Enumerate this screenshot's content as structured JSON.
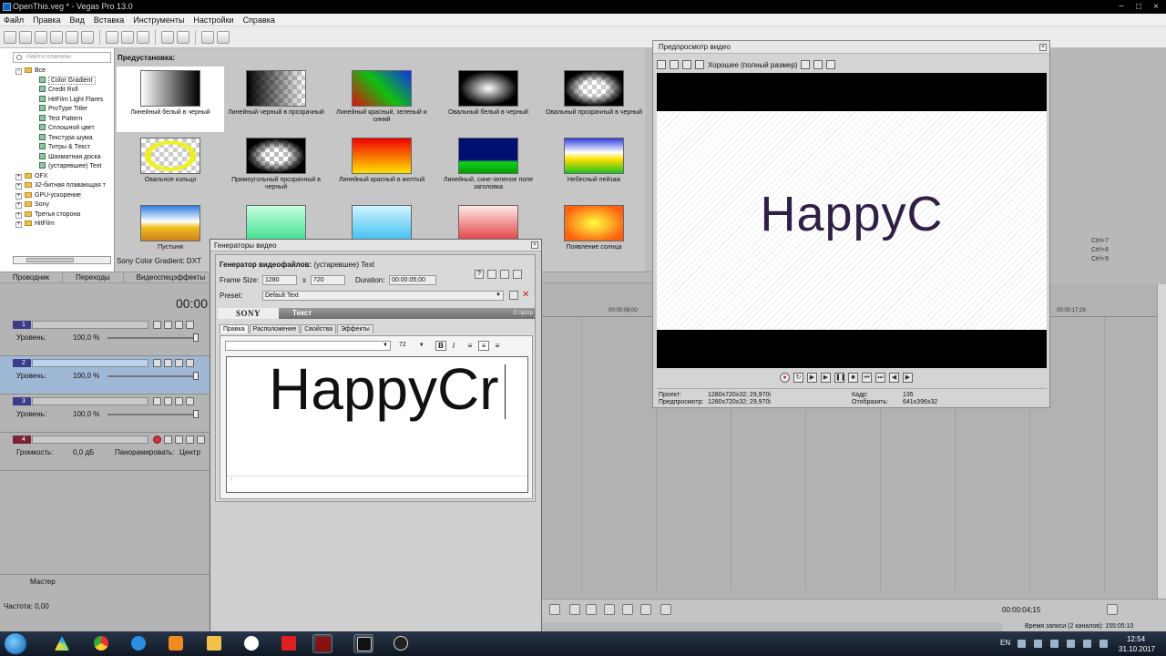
{
  "window": {
    "title": "OpenThis.veg * - Vegas Pro 13.0",
    "controls": [
      "−",
      "□",
      "×"
    ]
  },
  "menu": [
    "Файл",
    "Правка",
    "Вид",
    "Вставка",
    "Инструменты",
    "Настройки",
    "Справка"
  ],
  "explorer": {
    "search_placeholder": "Найти плагины",
    "tree": [
      {
        "label": "Все",
        "level": 0,
        "kind": "folder",
        "exp": "−"
      },
      {
        "label": "Color Gradient",
        "level": 1,
        "kind": "item",
        "selected": true
      },
      {
        "label": "Credit Roll",
        "level": 1,
        "kind": "item"
      },
      {
        "label": "HitFilm Light Flares",
        "level": 1,
        "kind": "item"
      },
      {
        "label": "ProType Titler",
        "level": 1,
        "kind": "item"
      },
      {
        "label": "Test Pattern",
        "level": 1,
        "kind": "item"
      },
      {
        "label": "Сплошной цвет",
        "level": 1,
        "kind": "item"
      },
      {
        "label": "Текстура шума",
        "level": 1,
        "kind": "item"
      },
      {
        "label": "Титры & Текст",
        "level": 1,
        "kind": "item"
      },
      {
        "label": "Шахматная доска",
        "level": 1,
        "kind": "item"
      },
      {
        "label": "(устаревшее) Text",
        "level": 1,
        "kind": "item"
      },
      {
        "label": "OFX",
        "level": 0,
        "kind": "folder",
        "exp": "+"
      },
      {
        "label": "32-битная плавающая т",
        "level": 0,
        "kind": "folder",
        "exp": "+"
      },
      {
        "label": "GPU-ускорение",
        "level": 0,
        "kind": "folder",
        "exp": "+"
      },
      {
        "label": "Sony",
        "level": 0,
        "kind": "folder",
        "exp": "+"
      },
      {
        "label": "Третья сторона",
        "level": 0,
        "kind": "folder",
        "exp": "+"
      },
      {
        "label": "HitFilm",
        "level": 0,
        "kind": "folder",
        "exp": "+"
      }
    ]
  },
  "presets": {
    "title": "Предустановка:",
    "status": "Sony Color Gradient: DXT",
    "items": [
      {
        "label": "Линейный белый в черный",
        "bg": "linear-gradient(90deg,#ffffff,#000000)",
        "selected": true
      },
      {
        "label": "Линейный черный в прозрачный",
        "bg": "linear-gradient(90deg,#000 0%,rgba(0,0,0,0) 100%),repeating-conic-gradient(#ccc 0% 25%,#fff 0% 50%) 0 0/10px 10px"
      },
      {
        "label": "Линейный красный, зеленый и синий",
        "bg": "linear-gradient(45deg,#e01010,#10c010 50%,#1030f0)"
      },
      {
        "label": "Овальный белый в черный",
        "bg": "radial-gradient(ellipse at center,#ffffff 0%,#000000 70%)"
      },
      {
        "label": "Овальный прозрачный в черный",
        "bg": "radial-gradient(ellipse at center,rgba(0,0,0,0) 30%,#000 72%),repeating-conic-gradient(#ccc 0% 25%,#fff 0% 50%) 0 0/10px 10px"
      },
      {
        "label": "Овальное кольцо",
        "bg": "radial-gradient(ellipse at center,rgba(0,0,0,0) 45%,#f0f020 50%,#f0f020 58%,rgba(0,0,0,0) 66%),repeating-conic-gradient(#ccc 0% 25%,#fff 0% 50%) 0 0/10px 10px"
      },
      {
        "label": "Прямоугольный прозрачный в черный",
        "bg": "radial-gradient(closest-side,rgba(0,0,0,0) 40%,#000 100%),repeating-conic-gradient(#bbb 0% 25%,#fff 0% 50%) 0 0/10px 10px"
      },
      {
        "label": "Линейный красный в желтый",
        "bg": "linear-gradient(180deg,#f00000,#ffe000)"
      },
      {
        "label": "Линейный, сине-зеленое поле заголовка",
        "bg": "linear-gradient(180deg,#001070 0%,#001070 62%,#10d020 68%,#00a000 100%)"
      },
      {
        "label": "Небесный пейзаж",
        "bg": "linear-gradient(180deg,#3040e0,#ffffff 40%,#ffe000 60%,#20c020)"
      },
      {
        "label": "Пустыня",
        "bg": "linear-gradient(180deg,#2d7fe0,#fff 45%,#f0c020 62%,#d08020)"
      },
      {
        "label": "",
        "bg": "linear-gradient(180deg,#c8ffe0,#40e090)"
      },
      {
        "label": "",
        "bg": "linear-gradient(180deg,#d0f4ff,#40c0f0)"
      },
      {
        "label": "",
        "bg": "linear-gradient(180deg,#ffe8e8,#e04040)"
      },
      {
        "label": "Появление солнца",
        "bg": "radial-gradient(ellipse at center,#ffff40 0%,#ff6010 80%)"
      }
    ]
  },
  "window_tabs": [
    "Проводник",
    "Переходы",
    "Видеоспецэффекты"
  ],
  "timeline": {
    "timecode": "00:00",
    "ruler": [
      "00:00:08;00",
      "00:00:17;29"
    ],
    "tracks": [
      {
        "num": "1",
        "level_label": "Уровень:",
        "level_value": "100,0 %",
        "selected": false,
        "type": "video"
      },
      {
        "num": "2",
        "level_label": "Уровень:",
        "level_value": "100,0 %",
        "selected": true,
        "type": "video"
      },
      {
        "num": "3",
        "level_label": "Уровень:",
        "level_value": "100,0 %",
        "selected": false,
        "type": "video"
      },
      {
        "num": "4",
        "level_label": "Громкость:",
        "level_value": "0,0 дБ",
        "pan_label": "Панорамировать:",
        "pan_value": "Центр",
        "selected": false,
        "type": "audio"
      }
    ],
    "master_label": "Мастер",
    "rate": "Частота: 0,00",
    "status_time": "00:00:04;15",
    "rec_info": "Время записи (2 каналов): 155:05:10"
  },
  "shortcuts": [
    "Ctrl+7",
    "Ctrl+8",
    "Ctrl+9"
  ],
  "preview": {
    "title": "Предпросмотр видео",
    "quality": "Хорошее (полный размер)",
    "text": "HappyC",
    "info": {
      "project_label": "Проект:",
      "project_value": "1280x720x32; 29,970i",
      "preview_label": "Предпросмотр:",
      "preview_value": "1280x720x32; 29,970i",
      "frame_label": "Кадр:",
      "frame_value": "135",
      "display_label": "Отобразить:",
      "display_value": "641x396x32"
    }
  },
  "generator": {
    "title": "Генераторы видео",
    "heading_bold": "Генератор видеофайлов:",
    "heading_value": "(устаревшее) Text",
    "frame_size_label": "Frame Size:",
    "width": "1280",
    "x_label": "x",
    "height": "720",
    "duration_label": "Duration:",
    "duration": "00:00:05;00",
    "preset_label": "Preset:",
    "preset_value": "Default Text",
    "sony": "SONY",
    "section": "Текст",
    "about": "О прогр",
    "tabs": [
      "Правка",
      "Расположение",
      "Свойства",
      "Эффекты"
    ],
    "font_size": "72",
    "bold": "B",
    "italic": "I",
    "text": "HappyCr"
  },
  "taskbar": {
    "lang": "EN",
    "time": "12:54",
    "date": "31.10.2017"
  }
}
